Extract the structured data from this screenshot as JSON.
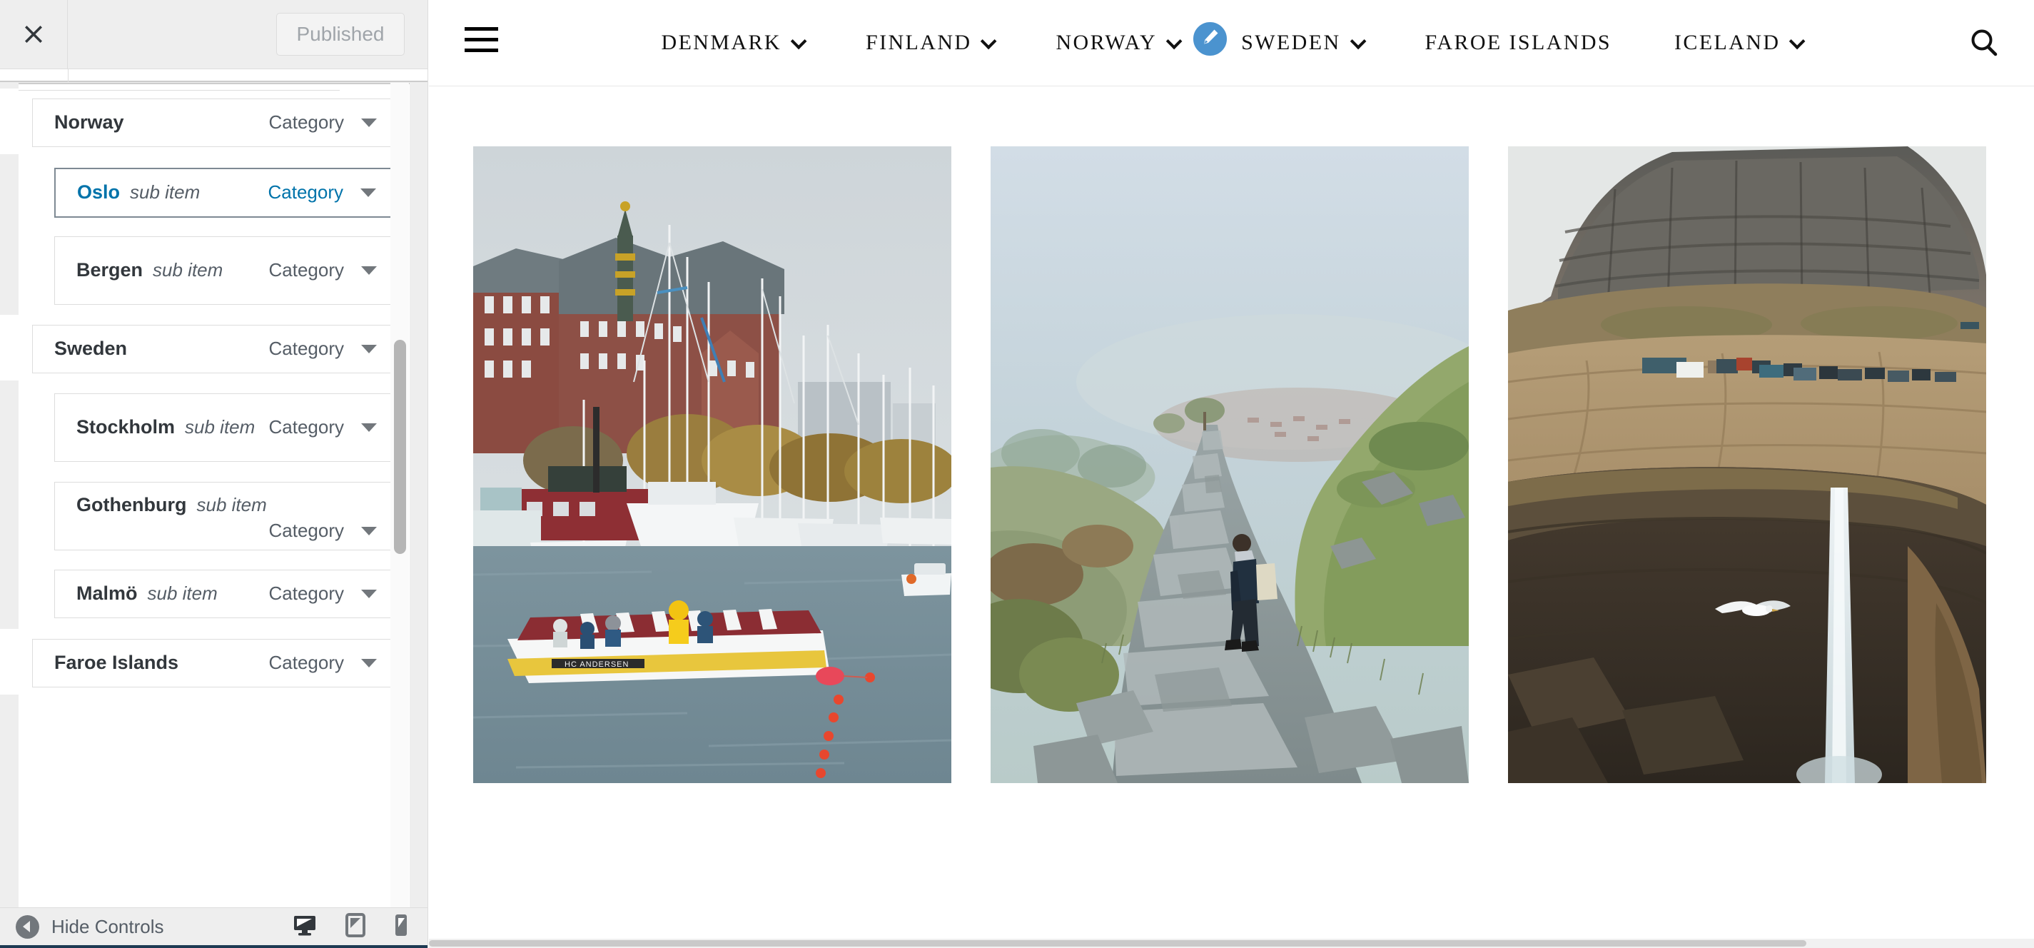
{
  "customizer": {
    "close_icon": "close-x-icon",
    "publish_label": "Published",
    "collapse_label": "Hide Controls",
    "collapse_icon": "chevron-left-circle-icon",
    "devices": [
      {
        "name": "desktop-preview",
        "icon": "desktop-icon",
        "active": true
      },
      {
        "name": "tablet-preview",
        "icon": "tablet-icon",
        "active": false
      },
      {
        "name": "mobile-preview",
        "icon": "mobile-icon",
        "active": false
      }
    ],
    "menu_items": [
      {
        "title": "Norway",
        "sub": "",
        "type": "Category",
        "depth": 0,
        "selected": false
      },
      {
        "title": "Oslo",
        "sub": "sub item",
        "type": "Category",
        "depth": 1,
        "selected": true
      },
      {
        "title": "Bergen",
        "sub": "sub item",
        "type": "Category",
        "depth": 1,
        "selected": false
      },
      {
        "title": "Sweden",
        "sub": "",
        "type": "Category",
        "depth": 0,
        "selected": false
      },
      {
        "title": "Stockholm",
        "sub": "sub item",
        "type": "Category",
        "depth": 1,
        "selected": false
      },
      {
        "title": "Gothenburg",
        "sub": "sub item",
        "type": "Category",
        "depth": 1,
        "selected": false
      },
      {
        "title": "Malmö",
        "sub": "sub item",
        "type": "Category",
        "depth": 1,
        "selected": false
      },
      {
        "title": "Faroe Islands",
        "sub": "",
        "type": "Category",
        "depth": 0,
        "selected": false
      }
    ],
    "colors": {
      "panel_bg": "#eeeeee",
      "item_bg": "#ffffff",
      "item_border": "#dddddd",
      "selected_border": "#7e8993",
      "link_blue": "#0073aa",
      "text_dark": "#32373c",
      "text_muted": "#555d66",
      "footer_accent": "#1d3a52"
    }
  },
  "site": {
    "hamburger_icon": "hamburger-menu-icon",
    "search_icon": "search-icon",
    "edit_badge_icon": "pencil-edit-icon",
    "edit_badge_color": "#4b93cf",
    "nav": [
      {
        "label": "Denmark",
        "has_chevron": true,
        "edit_badge": false
      },
      {
        "label": "Finland",
        "has_chevron": true,
        "edit_badge": false
      },
      {
        "label": "Norway",
        "has_chevron": true,
        "edit_badge": true
      },
      {
        "label": "Sweden",
        "has_chevron": true,
        "edit_badge": false
      },
      {
        "label": "Faroe Islands",
        "has_chevron": false,
        "edit_badge": false
      },
      {
        "label": "Iceland",
        "has_chevron": true,
        "edit_badge": false
      }
    ],
    "gallery": [
      {
        "name": "copenhagen-harbour-photo",
        "alt": "Copenhagen canal harbour with sailboats and the HC Andersen tour boat"
      },
      {
        "name": "bergen-mountain-trail-photo",
        "alt": "Hiker on a misty stone trail above Bergen"
      },
      {
        "name": "faroe-waterfall-photo",
        "alt": "Mulafossur waterfall and village below a Faroese cliff"
      }
    ]
  }
}
